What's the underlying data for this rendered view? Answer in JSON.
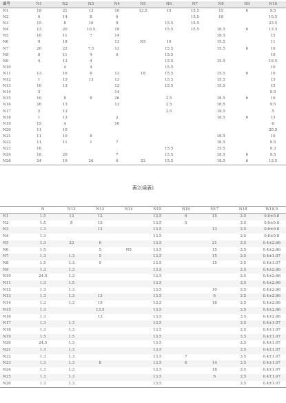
{
  "table1": {
    "headers": [
      "编号",
      "N1",
      "N2",
      "N3",
      "N4",
      "N5",
      "N6",
      "N7",
      "N8",
      "N9",
      "N10"
    ],
    "rows": [
      [
        "N1",
        "18",
        "21",
        "13",
        "10",
        "13.5",
        "15",
        "15.5",
        "15",
        "6",
        "9.5"
      ],
      [
        "N2",
        "6",
        "14",
        "8",
        "6",
        "",
        "",
        "15.5",
        "18",
        "",
        "10.5"
      ],
      [
        "N3",
        "15",
        "8",
        "10",
        "9",
        "",
        "15.5",
        "15.5",
        "",
        "",
        "23.5"
      ],
      [
        "N4",
        "13",
        "20",
        "10.5",
        "18",
        "",
        "15.5",
        "15.5",
        "18.5",
        "6",
        "13.5"
      ],
      [
        "N5",
        "10",
        "11",
        "7",
        "14",
        "",
        "",
        "",
        "18.5",
        "",
        "15"
      ],
      [
        "N6",
        "9",
        "18",
        "",
        "13",
        "N5",
        "16",
        "",
        "15.5",
        "",
        "11"
      ],
      [
        "N7",
        "20",
        "22",
        "7.5",
        "13",
        "",
        "15.5",
        "",
        "15.5",
        "6",
        "10"
      ],
      [
        "N8",
        "8",
        "11",
        "4",
        "6",
        "",
        "15.5",
        "",
        "",
        "",
        "10"
      ],
      [
        "N9",
        "4",
        "13",
        "4",
        "",
        "",
        "15.5",
        "",
        "15.5",
        "",
        "16.5"
      ],
      [
        "N10",
        "",
        "4",
        "4",
        "",
        "",
        "15.5",
        "",
        "",
        "",
        "10"
      ],
      [
        "N11",
        "13",
        "16",
        "6",
        "12",
        "18",
        "15.5",
        "",
        "15.5",
        "6",
        "10"
      ],
      [
        "N12",
        "1",
        "15",
        "13",
        "12",
        "",
        "15.5",
        "",
        "15.5",
        "",
        "15"
      ],
      [
        "N13",
        "10",
        "13",
        "",
        "12",
        "",
        "15.5",
        "",
        "15.5",
        "",
        "15"
      ],
      [
        "N14",
        "5",
        "",
        "",
        "14",
        "",
        "",
        "",
        "",
        "",
        "9.5"
      ],
      [
        "N15",
        "10",
        "8",
        "8",
        "26",
        "",
        "2.5",
        "",
        "18.5",
        "6",
        "10"
      ],
      [
        "N16",
        "26",
        "13",
        "",
        "13",
        "",
        "2.5",
        "",
        "18.5",
        "",
        "9.5"
      ],
      [
        "N17",
        "5",
        "13",
        "",
        "",
        "",
        "2.5",
        "",
        "18.5",
        "",
        "5"
      ],
      [
        "N18",
        "1",
        "13",
        "",
        "2",
        "",
        "",
        "",
        "18.5",
        "6",
        "15"
      ],
      [
        "N19",
        "15",
        "4",
        "",
        "10",
        "",
        "",
        "",
        "",
        "",
        "6"
      ],
      [
        "N20",
        "11",
        "10",
        "",
        "",
        "",
        "",
        "",
        "",
        "",
        "20.5"
      ],
      [
        "N21",
        "11",
        "10",
        "8",
        "",
        "",
        "",
        "",
        "18.5",
        "",
        "10"
      ],
      [
        "N22",
        "11",
        "11",
        "1",
        "7",
        "",
        "",
        "",
        "18.5",
        "",
        "9.5"
      ],
      [
        "N23",
        "16",
        "",
        "",
        "",
        "",
        "15.5",
        "",
        "15.5",
        "",
        "9.3"
      ],
      [
        "N24",
        "18",
        "20",
        "",
        "7",
        "",
        "15.5",
        "",
        "18.5",
        "6",
        "9.5"
      ],
      [
        "N26",
        "24",
        "19",
        "26",
        "6",
        "23",
        "15.5",
        "",
        "18.5",
        "6",
        "13.5"
      ]
    ]
  },
  "caption": "表2(续表)",
  "table2": {
    "headers": [
      "",
      "N",
      "N12",
      "N13",
      "N14",
      "N15",
      "N16",
      "N17",
      "N18",
      "W18.5"
    ],
    "rows": [
      [
        "N1",
        "1.5",
        "13",
        "12",
        "",
        "13.5",
        "6",
        "15",
        "3.5",
        "0.6±0.8"
      ],
      [
        "N2",
        "1.5",
        "8",
        "15",
        "",
        "13.5",
        "5",
        "",
        "3.5",
        "0.6±0.8"
      ],
      [
        "N3",
        "1.3",
        "",
        "12",
        "",
        "13.5",
        "",
        "13",
        "3.5",
        "0.6±0.8"
      ],
      [
        "N4",
        "1.3",
        "",
        "",
        "",
        "13.5",
        "",
        "",
        "3.5",
        "0.6±0.8"
      ],
      [
        "N5",
        "1.3",
        "23",
        "6",
        "",
        "13.5",
        "",
        "21",
        "3.5",
        "0.4±2.66"
      ],
      [
        "N6",
        "1.5",
        "",
        "5",
        "N5",
        "13.5",
        "",
        "15",
        "3.5",
        "0.4±2.66"
      ],
      [
        "N7",
        "1.3",
        "1.3",
        "5",
        "",
        "13.5",
        "",
        "15",
        "3.5",
        "0.4±1.07"
      ],
      [
        "N8",
        "1.5",
        "1.3",
        "9",
        "",
        "13.5",
        "",
        "15",
        "3.5",
        "0.4±1.07"
      ],
      [
        "N9",
        "1.3",
        "1.3",
        "",
        "",
        "13.5",
        "",
        "",
        "3.5",
        "0.4±2.66"
      ],
      [
        "N10",
        "24.5",
        "1.3",
        "",
        "",
        "13.5",
        "",
        "",
        "3.5",
        "0.4±2.66"
      ],
      [
        "N11",
        "1.3",
        "1.5",
        "",
        "",
        "13.5",
        "",
        "",
        "3.5",
        "0.4±2.66"
      ],
      [
        "N12",
        "1.3",
        "1.3",
        "",
        "",
        "13.5",
        "",
        "10",
        "3.5",
        "0.4±2.66"
      ],
      [
        "N13",
        "1.3",
        "1.3",
        "13",
        "",
        "13.5",
        "",
        "6",
        "3.5",
        "0.4±2.66"
      ],
      [
        "N14",
        "1.3",
        "1.3",
        "15",
        "",
        "13.5",
        "",
        "18",
        "3.5",
        "0.4±2.66"
      ],
      [
        "N15",
        "1.3",
        "",
        "13.5",
        "",
        "13.5",
        "",
        "",
        "3.5",
        "0.4±2.66"
      ],
      [
        "N16",
        "1.3",
        "",
        "13",
        "",
        "13.5",
        "",
        "",
        "3.5",
        "0.4±2.66"
      ],
      [
        "N17",
        "1.3",
        "1.3",
        "",
        "",
        "13.5",
        "",
        "",
        "3.5",
        "0.4±1.07"
      ],
      [
        "N18",
        "1.3",
        "1.3",
        "",
        "",
        "13.5",
        "",
        "",
        "3.5",
        "0.4±1.07"
      ],
      [
        "N19",
        "1.5",
        "1.5",
        "",
        "",
        "13.5",
        "",
        "",
        "3.5",
        "0.4±1.07"
      ],
      [
        "N20",
        "24.5",
        "1.3",
        "",
        "",
        "13.5",
        "",
        "",
        "3.5",
        "0.4±1.07"
      ],
      [
        "N21",
        "1.3",
        "1.3",
        "",
        "",
        "13.5",
        "",
        "",
        "3.5",
        "0.4±1.07"
      ],
      [
        "N22",
        "1.3",
        "1.3",
        "",
        "",
        "13.5",
        "7",
        "",
        "3.5",
        "0.4±1.07"
      ],
      [
        "N23",
        "1.3",
        "1.3",
        "8",
        "",
        "13.5",
        "6",
        "14",
        "3.5",
        "0.4±1.07"
      ],
      [
        "N24",
        "1.3",
        "1.3",
        "",
        "",
        "13.5",
        "",
        "18",
        "3.5",
        "0.4±1.07"
      ],
      [
        "N25",
        "1.3",
        "1.3",
        "",
        "",
        "13.5",
        "",
        "6",
        "3.5",
        "0.4±1.07"
      ],
      [
        "N26",
        "1.3",
        "1.3",
        "",
        "",
        "13.5",
        "",
        "",
        "3.5",
        "0.4±1.07"
      ]
    ]
  }
}
